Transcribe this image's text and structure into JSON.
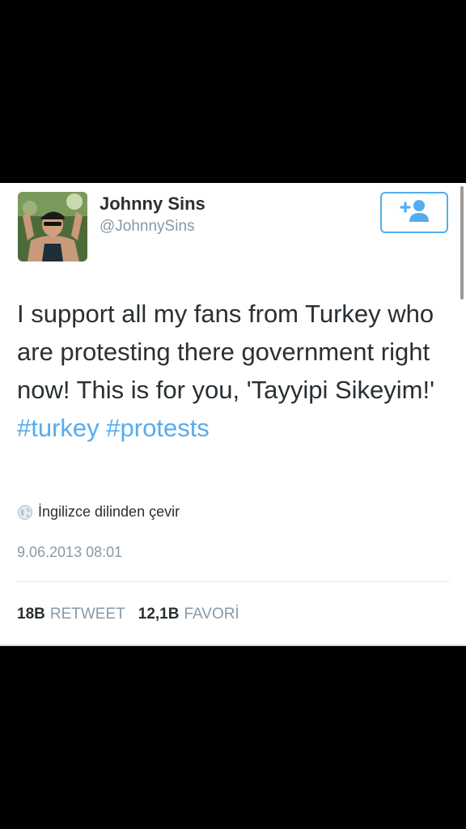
{
  "tweet": {
    "author_name": "Johnny Sins",
    "author_handle": "@JohnnySins",
    "text_parts": [
      "I support all my fans from Turkey who are protesting there government right now! This is for you, 'Tayyipi Sikeyim!' ",
      "#turkey",
      " ",
      "#protests"
    ],
    "translate_label": "İngilizce dilinden çevir",
    "timestamp": "9.06.2013 08:01",
    "retweets_count": "18B",
    "retweets_label": "RETWEET",
    "favorites_count": "12,1B",
    "favorites_label": "FAVORİ"
  },
  "icons": {
    "follow": "add-user-icon",
    "translate": "globe-icon"
  },
  "colors": {
    "accent": "#55acee",
    "text": "#292f33",
    "muted": "#8899a6",
    "background": "#000000",
    "card": "#ffffff"
  }
}
